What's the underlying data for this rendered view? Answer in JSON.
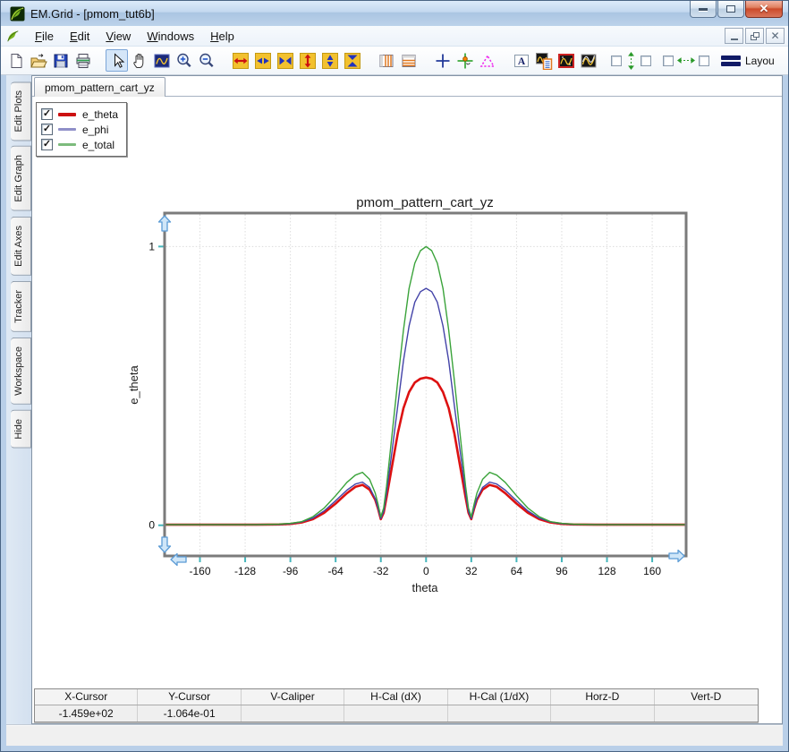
{
  "window": {
    "title": "EM.Grid - [pmom_tut6b]"
  },
  "menu": {
    "items": [
      {
        "u": "F",
        "rest": "ile"
      },
      {
        "u": "E",
        "rest": "dit"
      },
      {
        "u": "V",
        "rest": "iew"
      },
      {
        "u": "W",
        "rest": "indows"
      },
      {
        "u": "H",
        "rest": "elp"
      }
    ]
  },
  "toolbar": {
    "groups": [
      [
        "new-document",
        "open-file",
        "save",
        "print"
      ],
      [
        "select-tool",
        "pan-tool",
        "zoom-region",
        "zoom-in",
        "zoom-out"
      ],
      [
        "expand-horizontal",
        "stretch-horizontal",
        "shrink-horizontal",
        "expand-vertical",
        "stretch-vertical",
        "shrink-vertical"
      ],
      [
        "vertical-gridlines",
        "horizontal-gridlines"
      ],
      [
        "crosshair",
        "tracker",
        "caliper"
      ],
      [
        "text-annotation",
        "graph-properties",
        "graph-single",
        "graph-overlay"
      ],
      [
        "sync-vertical"
      ],
      [
        "sync-horizontal"
      ],
      [
        "layout"
      ]
    ],
    "active_tool": "select-tool",
    "layout_label": "Layou"
  },
  "sidebar": {
    "tabs": [
      "Edit Plots",
      "Edit Graph",
      "Edit Axes",
      "Tracker",
      "Workspace",
      "Hide"
    ]
  },
  "document": {
    "tab_label": "pmom_pattern_cart_yz"
  },
  "legend": {
    "items": [
      {
        "label": "e_theta",
        "checked": true,
        "swatch_color": "#cc1111",
        "weight": 4
      },
      {
        "label": "e_phi",
        "checked": true,
        "swatch_color": "#8f8fc8",
        "weight": 3
      },
      {
        "label": "e_total",
        "checked": true,
        "swatch_color": "#7cbb7c",
        "weight": 3
      }
    ]
  },
  "status_table": {
    "columns": [
      "X-Cursor",
      "Y-Cursor",
      "V-Caliper",
      "H-Cal (dX)",
      "H-Cal (1/dX)",
      "Horz-D",
      "Vert-D"
    ],
    "values": [
      "-1.459e+02",
      "-1.064e-01",
      "",
      "",
      "",
      "",
      ""
    ]
  },
  "chart_data": {
    "type": "line",
    "title": "pmom_pattern_cart_yz",
    "xlabel": "theta",
    "ylabel": "e_theta",
    "x_ticks": [
      -160,
      -128,
      -96,
      -64,
      -32,
      0,
      32,
      64,
      96,
      128,
      160
    ],
    "y_ticks": [
      0,
      1
    ],
    "xlim": [
      -185,
      184
    ],
    "ylim": [
      -0.11,
      1.12
    ],
    "grid": true,
    "legend_position": "floating-top-left",
    "frame_color": "#7b7b7b",
    "tick_color": "#45b6bc",
    "grid_color": "#dcdcdc",
    "x": [
      -185,
      -180,
      -160,
      -140,
      -120,
      -104,
      -96,
      -88,
      -80,
      -72,
      -64,
      -56,
      -50,
      -45,
      -40,
      -36,
      -34,
      -32,
      -30,
      -28,
      -24,
      -20,
      -16,
      -12,
      -8,
      -4,
      0,
      4,
      8,
      12,
      16,
      20,
      24,
      28,
      30,
      32,
      34,
      36,
      40,
      45,
      50,
      56,
      64,
      72,
      80,
      88,
      96,
      104,
      120,
      140,
      160,
      180,
      185
    ],
    "series": [
      {
        "name": "e_theta",
        "color": "#dd1111",
        "width": 2.6,
        "values": [
          0.002,
          0.002,
          0.002,
          0.002,
          0.002,
          0.003,
          0.005,
          0.01,
          0.022,
          0.045,
          0.078,
          0.115,
          0.138,
          0.145,
          0.128,
          0.092,
          0.06,
          0.022,
          0.045,
          0.1,
          0.215,
          0.33,
          0.42,
          0.478,
          0.512,
          0.526,
          0.53,
          0.526,
          0.512,
          0.478,
          0.42,
          0.33,
          0.215,
          0.1,
          0.045,
          0.022,
          0.06,
          0.092,
          0.128,
          0.145,
          0.138,
          0.115,
          0.078,
          0.045,
          0.022,
          0.01,
          0.005,
          0.003,
          0.002,
          0.002,
          0.002,
          0.002,
          0.002
        ]
      },
      {
        "name": "e_phi",
        "color": "#4343a8",
        "width": 1.4,
        "values": [
          0.002,
          0.002,
          0.002,
          0.002,
          0.002,
          0.003,
          0.006,
          0.012,
          0.026,
          0.052,
          0.088,
          0.126,
          0.148,
          0.155,
          0.136,
          0.096,
          0.062,
          0.024,
          0.05,
          0.115,
          0.27,
          0.43,
          0.59,
          0.715,
          0.8,
          0.838,
          0.85,
          0.838,
          0.8,
          0.715,
          0.59,
          0.43,
          0.27,
          0.115,
          0.05,
          0.024,
          0.062,
          0.096,
          0.136,
          0.155,
          0.148,
          0.126,
          0.088,
          0.052,
          0.026,
          0.012,
          0.006,
          0.003,
          0.002,
          0.002,
          0.002,
          0.002,
          0.002
        ]
      },
      {
        "name": "e_total",
        "color": "#3aa33a",
        "width": 1.4,
        "values": [
          0.002,
          0.002,
          0.002,
          0.002,
          0.002,
          0.004,
          0.007,
          0.013,
          0.031,
          0.062,
          0.106,
          0.154,
          0.18,
          0.19,
          0.165,
          0.116,
          0.076,
          0.03,
          0.062,
          0.14,
          0.33,
          0.52,
          0.7,
          0.85,
          0.94,
          0.985,
          1.0,
          0.985,
          0.94,
          0.85,
          0.7,
          0.52,
          0.33,
          0.14,
          0.062,
          0.03,
          0.076,
          0.116,
          0.165,
          0.19,
          0.18,
          0.154,
          0.106,
          0.062,
          0.031,
          0.013,
          0.007,
          0.004,
          0.002,
          0.002,
          0.002,
          0.002,
          0.002
        ]
      }
    ]
  }
}
